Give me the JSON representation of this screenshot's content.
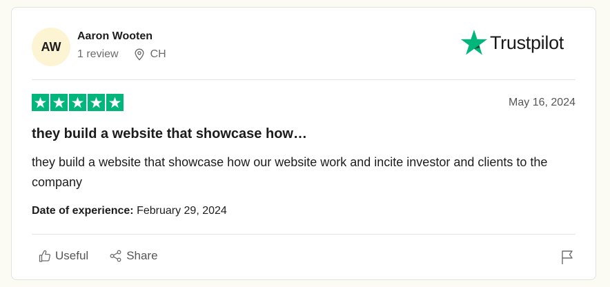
{
  "reviewer": {
    "initials": "AW",
    "name": "Aaron Wooten",
    "review_count": "1 review",
    "location": "CH"
  },
  "brand": {
    "name": "Trustpilot",
    "star_color": "#00b67a"
  },
  "review": {
    "rating": 5,
    "rating_max": 5,
    "date": "May 16, 2024",
    "title": "they build a website that showcase how…",
    "body": "they build a website that showcase how our website work and incite investor and clients to the company",
    "experience_label": "Date of experience:",
    "experience_date": "February 29, 2024"
  },
  "actions": {
    "useful_label": "Useful",
    "share_label": "Share"
  },
  "icons": {
    "location": "map-pin-icon",
    "useful": "thumbs-up-icon",
    "share": "share-icon",
    "report": "flag-icon"
  }
}
